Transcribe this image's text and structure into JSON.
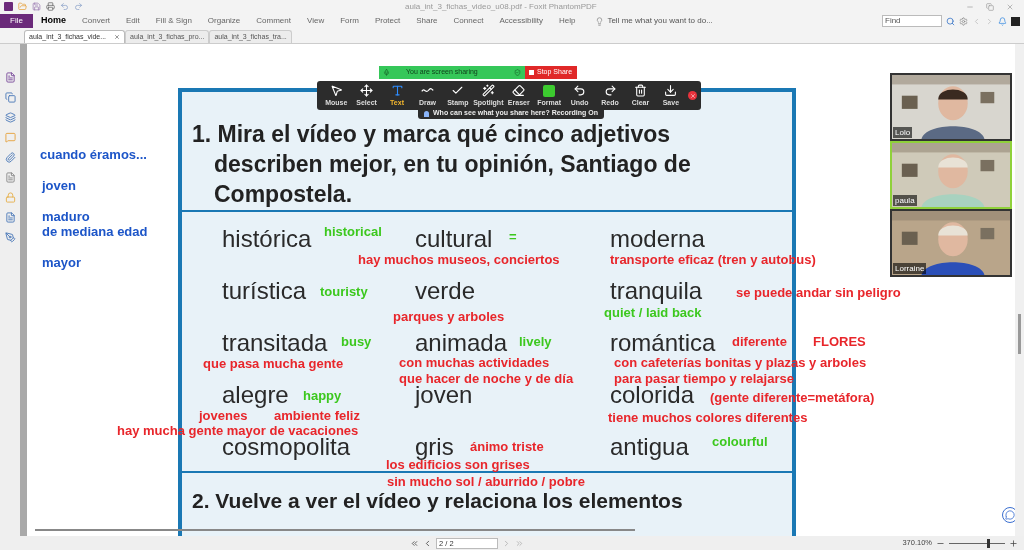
{
  "window": {
    "title": "aula_int_3_fichas_video_u08.pdf - Foxit PhantomPDF"
  },
  "menu": [
    {
      "label": "File",
      "kind": "file"
    },
    {
      "label": "Home",
      "kind": "tab",
      "selected": true
    },
    {
      "label": "Convert",
      "kind": "tab",
      "selected": false
    },
    {
      "label": "Edit",
      "kind": "tab",
      "selected": false
    },
    {
      "label": "Fill & Sign",
      "kind": "tab",
      "selected": false
    },
    {
      "label": "Organize",
      "kind": "tab",
      "selected": false
    },
    {
      "label": "Comment",
      "kind": "tab",
      "selected": false
    },
    {
      "label": "View",
      "kind": "tab",
      "selected": false
    },
    {
      "label": "Form",
      "kind": "tab",
      "selected": false
    },
    {
      "label": "Protect",
      "kind": "tab",
      "selected": false
    },
    {
      "label": "Share",
      "kind": "tab",
      "selected": false
    },
    {
      "label": "Connect",
      "kind": "tab",
      "selected": false
    },
    {
      "label": "Accessibility",
      "kind": "tab",
      "selected": false
    },
    {
      "label": "Help",
      "kind": "tab",
      "selected": false
    }
  ],
  "tell_me": {
    "placeholder": "Tell me what you want to do..."
  },
  "find": {
    "placeholder": "Find"
  },
  "doc_tabs": [
    {
      "label": "aula_int_3_fichas_vide...",
      "selected": true
    },
    {
      "label": "aula_int_3_fichas_pro...",
      "selected": false
    },
    {
      "label": "aula_int_3_fichas_tra...",
      "selected": false
    }
  ],
  "share_bar": {
    "status": "You are screen sharing",
    "stop": "Stop Share"
  },
  "annotate_tools": [
    {
      "label": "Mouse",
      "kind": "mouse",
      "selected": false
    },
    {
      "label": "Select",
      "kind": "select",
      "selected": false
    },
    {
      "label": "Text",
      "kind": "text",
      "selected": true
    },
    {
      "label": "Draw",
      "kind": "draw",
      "selected": false
    },
    {
      "label": "Stamp",
      "kind": "stamp",
      "selected": false
    },
    {
      "label": "Spotlight",
      "kind": "spotlight",
      "selected": false
    },
    {
      "label": "Eraser",
      "kind": "eraser",
      "selected": false
    },
    {
      "label": "Format",
      "kind": "format",
      "selected": false
    },
    {
      "label": "Undo",
      "kind": "undo",
      "selected": false
    },
    {
      "label": "Redo",
      "kind": "redo",
      "selected": false
    },
    {
      "label": "Clear",
      "kind": "clear",
      "selected": false
    },
    {
      "label": "Save",
      "kind": "save",
      "selected": false
    }
  ],
  "share_notice": "Who can see what you share here? Recording On",
  "side_notes": [
    "cuando éramos...",
    "joven",
    "maduro",
    "de mediana edad",
    "mayor"
  ],
  "question_1": "1. Mira el vídeo y marca qué cinco adjetivos describen mejor, en tu opinión, Santiago de Compostela.",
  "adjectives": [
    "histórica",
    "cultural",
    "moderna",
    "turística",
    "verde",
    "tranquila",
    "transitada",
    "animada",
    "romántica",
    "alegre",
    "joven",
    "colorida",
    "cosmopolita",
    "gris",
    "antigua"
  ],
  "annotations": [
    {
      "text": "historical",
      "color": "#3cc81e"
    },
    {
      "text": "=",
      "color": "#3cc81e"
    },
    {
      "text": "hay muchos museos, conciertos",
      "color": "#e8262b"
    },
    {
      "text": "transporte eficaz (tren y autobus)",
      "color": "#e8262b"
    },
    {
      "text": "touristy",
      "color": "#3cc81e"
    },
    {
      "text": "se puede andar sin peligro",
      "color": "#e8262b"
    },
    {
      "text": "parques y arboles",
      "color": "#e8262b"
    },
    {
      "text": "quiet / laid back",
      "color": "#3cc81e"
    },
    {
      "text": "busy",
      "color": "#3cc81e"
    },
    {
      "text": "lively",
      "color": "#3cc81e"
    },
    {
      "text": "diferente",
      "color": "#e8262b"
    },
    {
      "text": "FLORES",
      "color": "#e8262b"
    },
    {
      "text": "que pasa mucha gente",
      "color": "#e8262b"
    },
    {
      "text": "con muchas actividades",
      "color": "#e8262b"
    },
    {
      "text": "con cafeterías bonitas y plazas y arboles",
      "color": "#e8262b"
    },
    {
      "text": "que hacer de noche y de día",
      "color": "#e8262b"
    },
    {
      "text": "para pasar tiempo y relajarse",
      "color": "#e8262b"
    },
    {
      "text": "happy",
      "color": "#3cc81e"
    },
    {
      "text": "(gente diferente=metáfora)",
      "color": "#e8262b"
    },
    {
      "text": "jovenes",
      "color": "#e8262b"
    },
    {
      "text": "ambiente feliz",
      "color": "#e8262b"
    },
    {
      "text": "tiene muchos colores diferentes",
      "color": "#e8262b"
    },
    {
      "text": "hay mucha gente mayor de vacaciones",
      "color": "#e8262b"
    },
    {
      "text": "colourful",
      "color": "#3cc81e"
    },
    {
      "text": "ánimo triste",
      "color": "#e8262b"
    },
    {
      "text": "los edificios son grises",
      "color": "#e8262b"
    },
    {
      "text": "sin mucho sol / aburrido / pobre",
      "color": "#e8262b"
    }
  ],
  "question_2": "2. Vuelve a ver el vídeo y relaciona los elementos",
  "participants": [
    {
      "name": "Lolo",
      "selected": false
    },
    {
      "name": "paula",
      "selected": true
    },
    {
      "name": "Lorraine",
      "selected": false
    }
  ],
  "status_bar": {
    "page": "2 / 2",
    "zoom": "370.10%"
  },
  "zoom_slider": {
    "level": 0.7
  }
}
